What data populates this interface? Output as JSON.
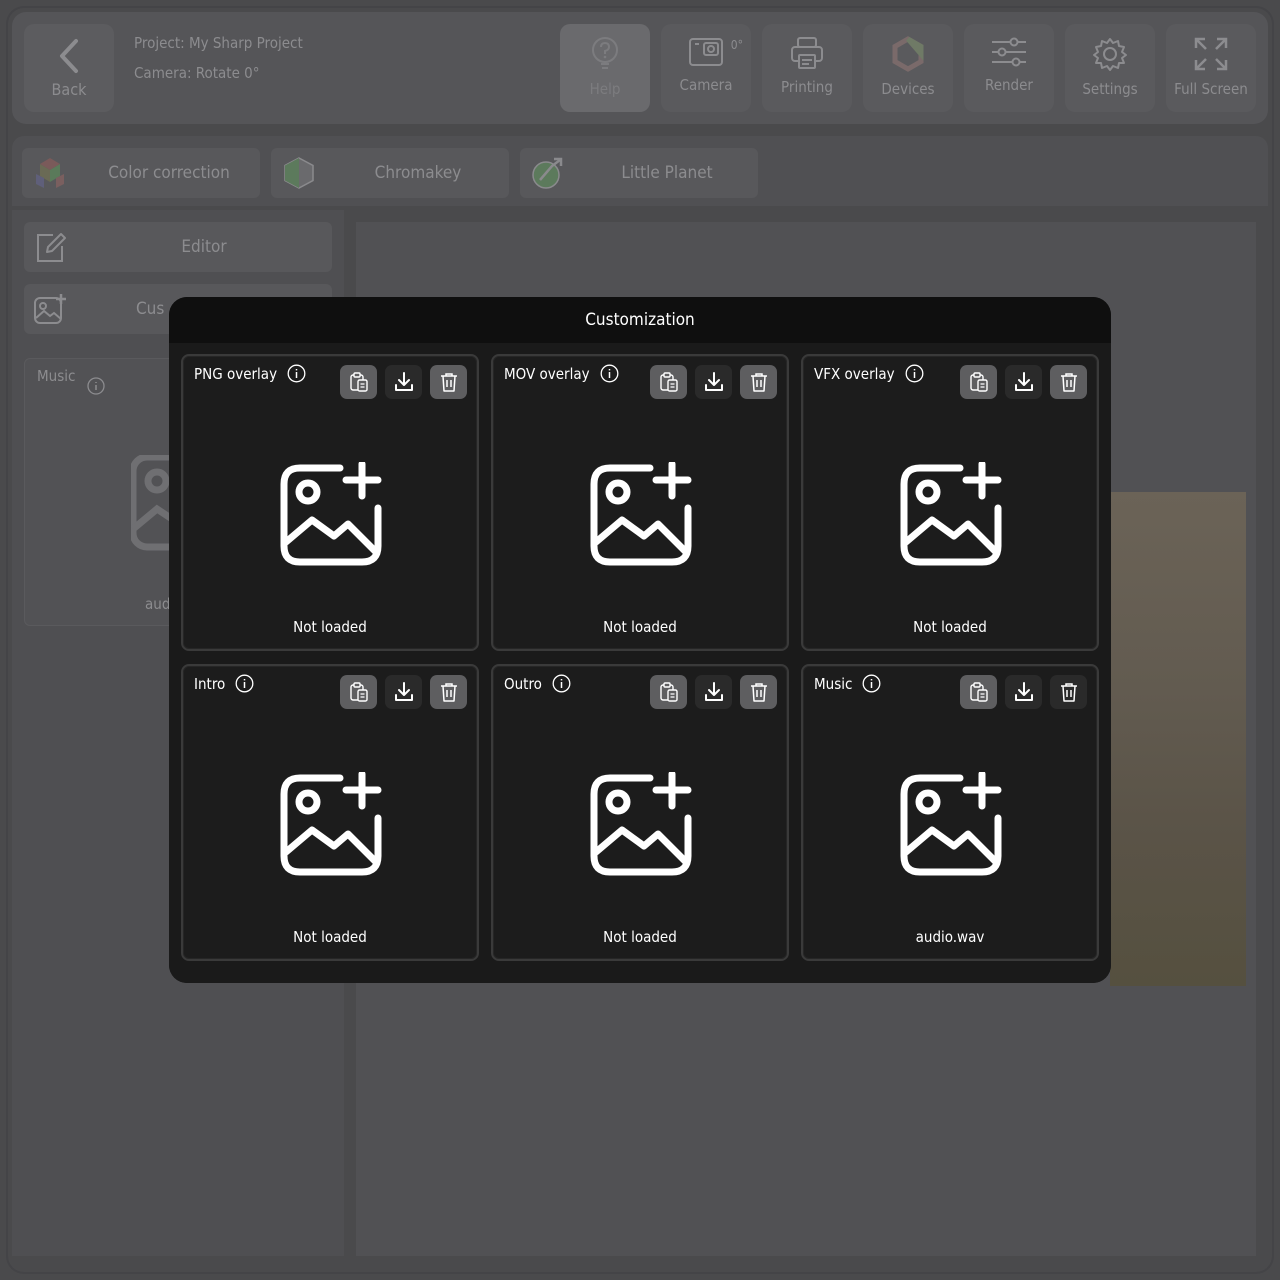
{
  "header": {
    "back_label": "Back",
    "project_line": "Project: My Sharp Project",
    "camera_line": "Camera: Rotate 0°",
    "camera_badge": "0°",
    "tools": [
      {
        "label": "Help",
        "icon": "help-icon"
      },
      {
        "label": "Camera",
        "icon": "camera-icon"
      },
      {
        "label": "Printing",
        "icon": "printer-icon"
      },
      {
        "label": "Devices",
        "icon": "hexagon-icon"
      },
      {
        "label": "Render",
        "icon": "sliders-icon"
      },
      {
        "label": "Settings",
        "icon": "gear-icon"
      },
      {
        "label": "Full Screen",
        "icon": "fullscreen-icon"
      }
    ]
  },
  "effects": [
    {
      "label": "Color correction",
      "icon": "color-cube-icon"
    },
    {
      "label": "Chromakey",
      "icon": "chromakey-icon"
    },
    {
      "label": "Little Planet",
      "icon": "planet-icon"
    }
  ],
  "sidebar": {
    "editor_label": "Editor",
    "custom_label": "Cus",
    "music_title": "Music",
    "music_file": "aud"
  },
  "modal": {
    "title": "Customization",
    "cards": [
      {
        "title": "PNG overlay",
        "status": "Not loaded"
      },
      {
        "title": "MOV overlay",
        "status": "Not loaded"
      },
      {
        "title": "VFX overlay",
        "status": "Not loaded"
      },
      {
        "title": "Intro",
        "status": "Not loaded"
      },
      {
        "title": "Outro",
        "status": "Not loaded"
      },
      {
        "title": "Music",
        "status": "audio.wav"
      }
    ]
  },
  "colors": {
    "modal_bg": "#1a1a1a",
    "action_gray": "#5e5e60",
    "backdrop": "#4a4a4c"
  }
}
